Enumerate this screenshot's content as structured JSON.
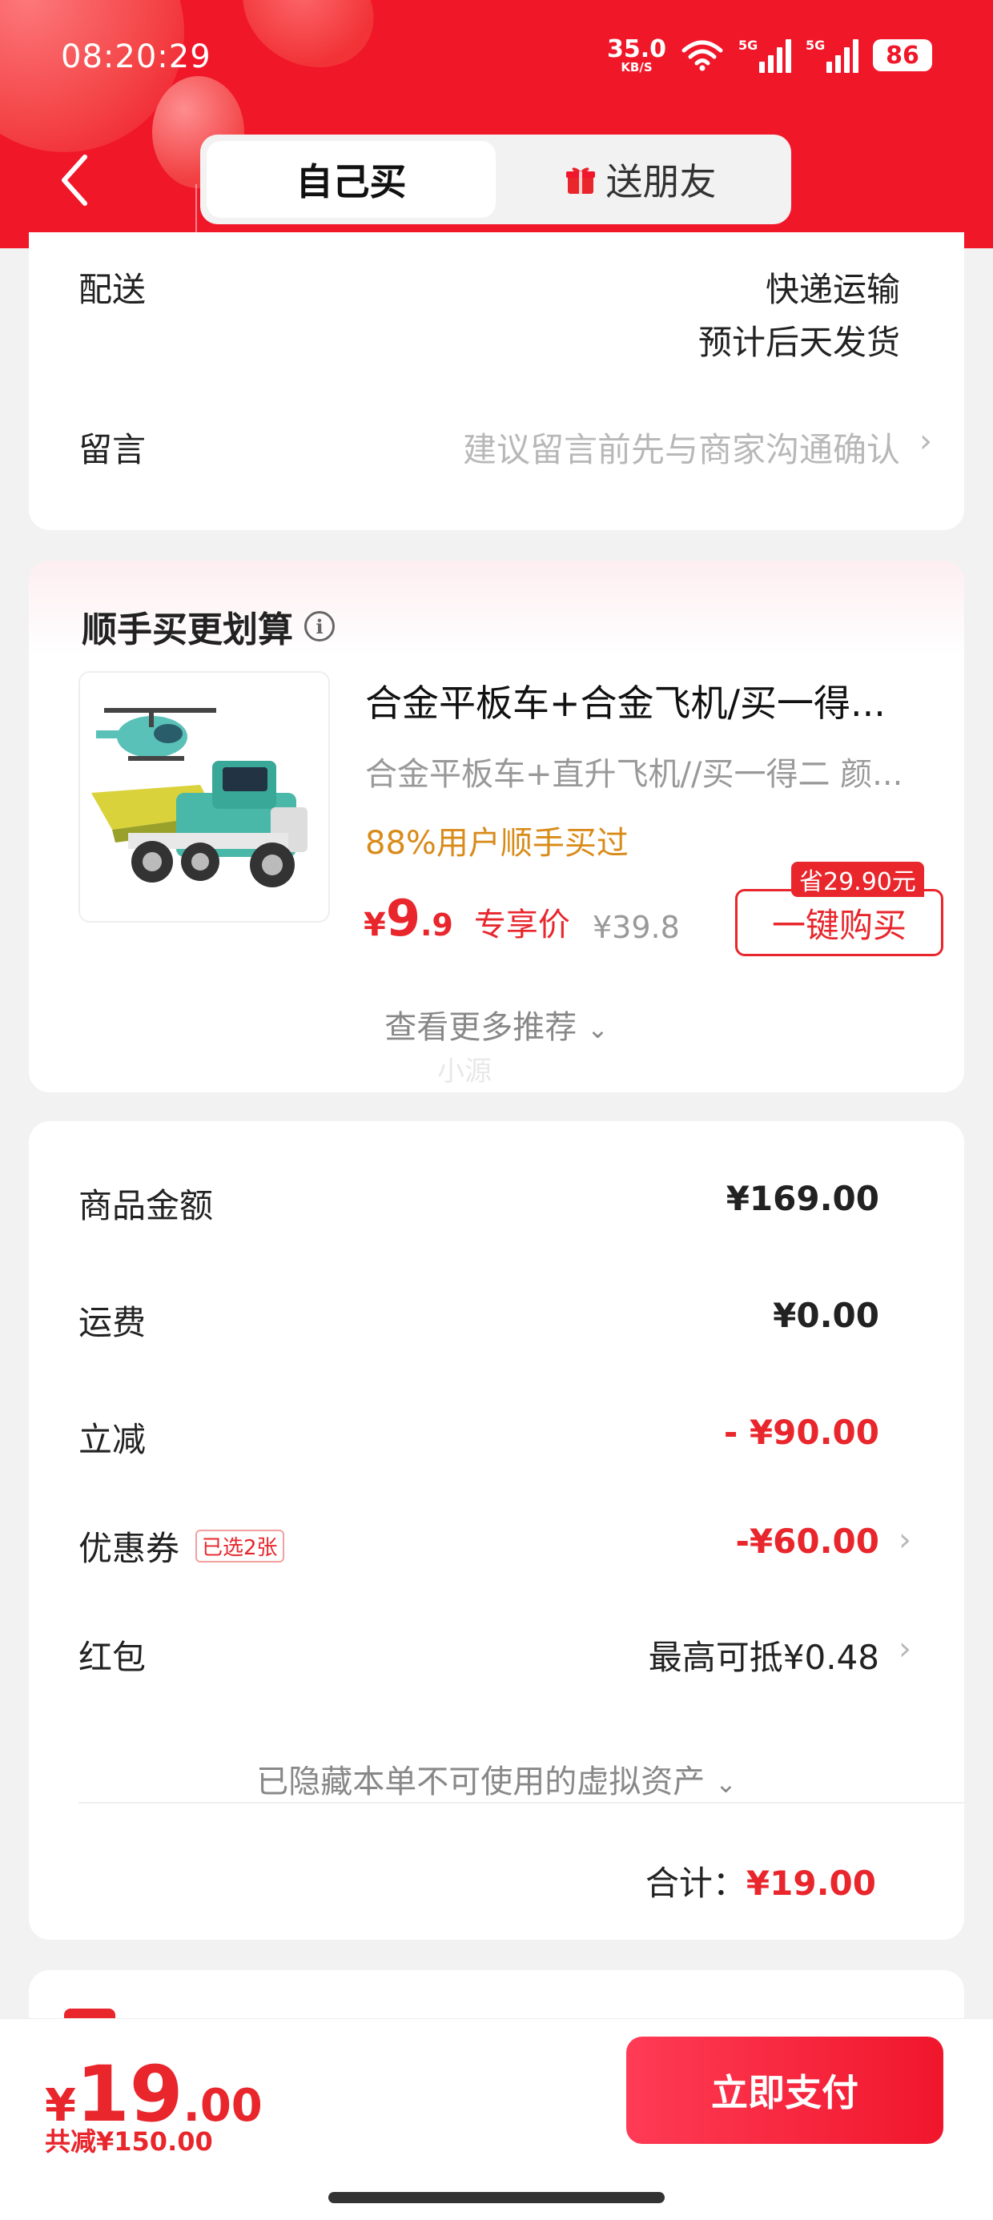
{
  "status_bar": {
    "time": "08:20:29",
    "net_speed_value": "35.0",
    "net_speed_unit": "KB/S",
    "signal1_label": "5G",
    "signal2_label": "5G",
    "battery": "86"
  },
  "header": {
    "tabs": [
      {
        "label": "自己买",
        "active": true
      },
      {
        "label": "送朋友",
        "active": false
      }
    ]
  },
  "delivery": {
    "label": "配送",
    "method": "快递运输",
    "eta": "预计后天发货"
  },
  "message": {
    "label": "留言",
    "placeholder": "建议留言前先与商家沟通确认"
  },
  "upsell": {
    "title": "顺手买更划算",
    "product_name": "合金平板车+合金飞机/买一得...",
    "product_spec": "合金平板车+直升飞机//买一得二   颜...",
    "social_proof": "88%用户顺手买过",
    "price_currency": "¥",
    "price_int": "9",
    "price_dec": ".9",
    "price_tag": "专享价",
    "original_price": "¥39.8",
    "save_badge": "省29.90元",
    "buy_button": "一键购买",
    "more_label": "查看更多推荐",
    "watermark": "小源"
  },
  "summary": {
    "rows": [
      {
        "label": "商品金额",
        "value": "¥169.00"
      },
      {
        "label": "运费",
        "value": "¥0.00"
      },
      {
        "label": "立减",
        "value": "- ¥90.00"
      },
      {
        "label": "优惠券",
        "tag": "已选2张",
        "value": "-¥60.00"
      },
      {
        "label": "红包",
        "value": "最高可抵¥0.48"
      }
    ],
    "hidden_assets": "已隐藏本单不可使用的虚拟资产",
    "total_label": "合计：",
    "total_value": "¥19.00"
  },
  "bottom_bar": {
    "currency": "¥",
    "price_int": "19",
    "price_dec": ".00",
    "saved": "共减¥150.00",
    "pay_button": "立即支付"
  },
  "colors": {
    "brand_red": "#f01729",
    "accent_red": "#e8262c",
    "social_orange": "#d98b1a"
  }
}
